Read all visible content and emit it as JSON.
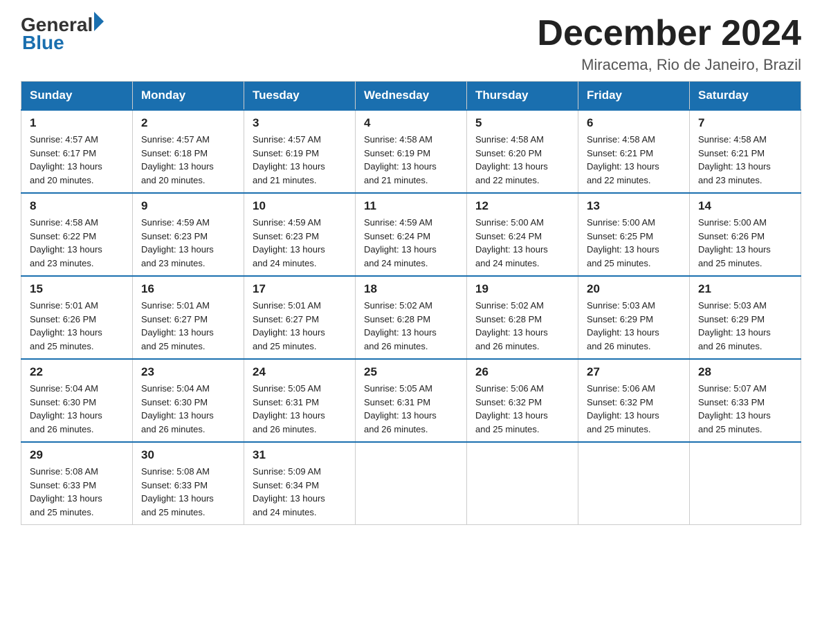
{
  "logo": {
    "text_general": "General",
    "text_blue": "Blue"
  },
  "header": {
    "month_title": "December 2024",
    "location": "Miracema, Rio de Janeiro, Brazil"
  },
  "days_of_week": [
    "Sunday",
    "Monday",
    "Tuesday",
    "Wednesday",
    "Thursday",
    "Friday",
    "Saturday"
  ],
  "weeks": [
    [
      {
        "day": "1",
        "sunrise": "4:57 AM",
        "sunset": "6:17 PM",
        "daylight": "13 hours and 20 minutes."
      },
      {
        "day": "2",
        "sunrise": "4:57 AM",
        "sunset": "6:18 PM",
        "daylight": "13 hours and 20 minutes."
      },
      {
        "day": "3",
        "sunrise": "4:57 AM",
        "sunset": "6:19 PM",
        "daylight": "13 hours and 21 minutes."
      },
      {
        "day": "4",
        "sunrise": "4:58 AM",
        "sunset": "6:19 PM",
        "daylight": "13 hours and 21 minutes."
      },
      {
        "day": "5",
        "sunrise": "4:58 AM",
        "sunset": "6:20 PM",
        "daylight": "13 hours and 22 minutes."
      },
      {
        "day": "6",
        "sunrise": "4:58 AM",
        "sunset": "6:21 PM",
        "daylight": "13 hours and 22 minutes."
      },
      {
        "day": "7",
        "sunrise": "4:58 AM",
        "sunset": "6:21 PM",
        "daylight": "13 hours and 23 minutes."
      }
    ],
    [
      {
        "day": "8",
        "sunrise": "4:58 AM",
        "sunset": "6:22 PM",
        "daylight": "13 hours and 23 minutes."
      },
      {
        "day": "9",
        "sunrise": "4:59 AM",
        "sunset": "6:23 PM",
        "daylight": "13 hours and 23 minutes."
      },
      {
        "day": "10",
        "sunrise": "4:59 AM",
        "sunset": "6:23 PM",
        "daylight": "13 hours and 24 minutes."
      },
      {
        "day": "11",
        "sunrise": "4:59 AM",
        "sunset": "6:24 PM",
        "daylight": "13 hours and 24 minutes."
      },
      {
        "day": "12",
        "sunrise": "5:00 AM",
        "sunset": "6:24 PM",
        "daylight": "13 hours and 24 minutes."
      },
      {
        "day": "13",
        "sunrise": "5:00 AM",
        "sunset": "6:25 PM",
        "daylight": "13 hours and 25 minutes."
      },
      {
        "day": "14",
        "sunrise": "5:00 AM",
        "sunset": "6:26 PM",
        "daylight": "13 hours and 25 minutes."
      }
    ],
    [
      {
        "day": "15",
        "sunrise": "5:01 AM",
        "sunset": "6:26 PM",
        "daylight": "13 hours and 25 minutes."
      },
      {
        "day": "16",
        "sunrise": "5:01 AM",
        "sunset": "6:27 PM",
        "daylight": "13 hours and 25 minutes."
      },
      {
        "day": "17",
        "sunrise": "5:01 AM",
        "sunset": "6:27 PM",
        "daylight": "13 hours and 25 minutes."
      },
      {
        "day": "18",
        "sunrise": "5:02 AM",
        "sunset": "6:28 PM",
        "daylight": "13 hours and 26 minutes."
      },
      {
        "day": "19",
        "sunrise": "5:02 AM",
        "sunset": "6:28 PM",
        "daylight": "13 hours and 26 minutes."
      },
      {
        "day": "20",
        "sunrise": "5:03 AM",
        "sunset": "6:29 PM",
        "daylight": "13 hours and 26 minutes."
      },
      {
        "day": "21",
        "sunrise": "5:03 AM",
        "sunset": "6:29 PM",
        "daylight": "13 hours and 26 minutes."
      }
    ],
    [
      {
        "day": "22",
        "sunrise": "5:04 AM",
        "sunset": "6:30 PM",
        "daylight": "13 hours and 26 minutes."
      },
      {
        "day": "23",
        "sunrise": "5:04 AM",
        "sunset": "6:30 PM",
        "daylight": "13 hours and 26 minutes."
      },
      {
        "day": "24",
        "sunrise": "5:05 AM",
        "sunset": "6:31 PM",
        "daylight": "13 hours and 26 minutes."
      },
      {
        "day": "25",
        "sunrise": "5:05 AM",
        "sunset": "6:31 PM",
        "daylight": "13 hours and 26 minutes."
      },
      {
        "day": "26",
        "sunrise": "5:06 AM",
        "sunset": "6:32 PM",
        "daylight": "13 hours and 25 minutes."
      },
      {
        "day": "27",
        "sunrise": "5:06 AM",
        "sunset": "6:32 PM",
        "daylight": "13 hours and 25 minutes."
      },
      {
        "day": "28",
        "sunrise": "5:07 AM",
        "sunset": "6:33 PM",
        "daylight": "13 hours and 25 minutes."
      }
    ],
    [
      {
        "day": "29",
        "sunrise": "5:08 AM",
        "sunset": "6:33 PM",
        "daylight": "13 hours and 25 minutes."
      },
      {
        "day": "30",
        "sunrise": "5:08 AM",
        "sunset": "6:33 PM",
        "daylight": "13 hours and 25 minutes."
      },
      {
        "day": "31",
        "sunrise": "5:09 AM",
        "sunset": "6:34 PM",
        "daylight": "13 hours and 24 minutes."
      },
      null,
      null,
      null,
      null
    ]
  ],
  "labels": {
    "sunrise": "Sunrise:",
    "sunset": "Sunset:",
    "daylight": "Daylight:"
  }
}
